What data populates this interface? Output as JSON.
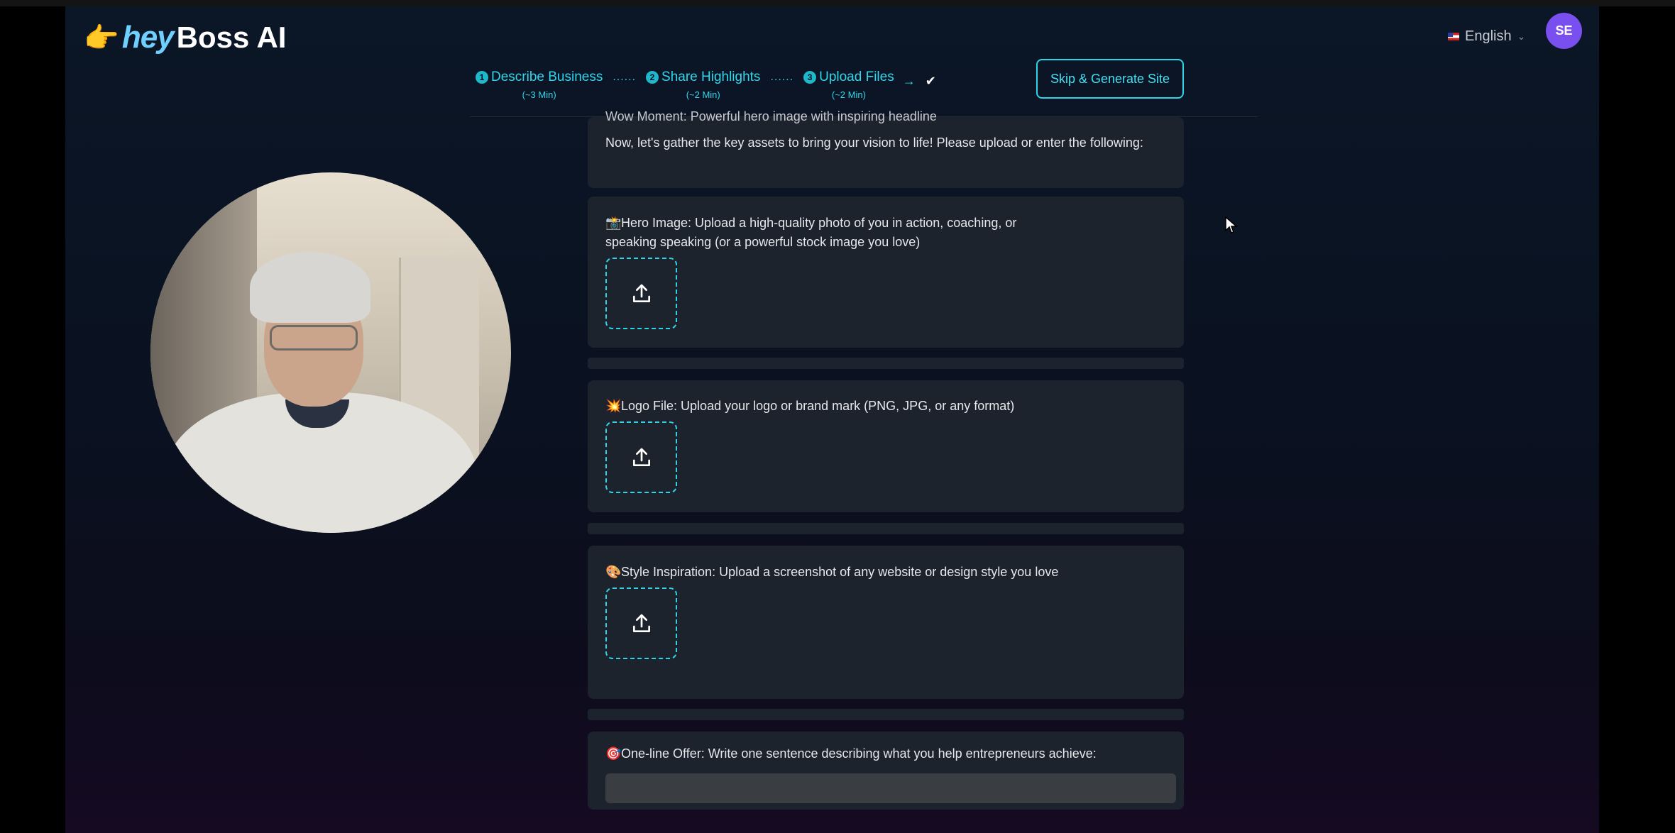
{
  "header": {
    "logo_hey": "hey",
    "logo_boss": "Boss AI",
    "language": "English",
    "avatar_initials": "SE",
    "skip_button": "Skip & Generate Site"
  },
  "steps": [
    {
      "num": "1",
      "label": "Describe Business",
      "duration": "(~3 Min)"
    },
    {
      "num": "2",
      "label": "Share Highlights",
      "duration": "(~2 Min)"
    },
    {
      "num": "3",
      "label": "Upload Files",
      "duration": "(~2 Min)"
    }
  ],
  "steps_separator": "......",
  "intro": {
    "cut_line": "Wow Moment: Powerful hero image with inspiring headline",
    "text": "Now, let's gather the key assets to bring your vision to life! Please upload or enter the following:"
  },
  "hero_image": {
    "emoji": "📸",
    "label": "Hero Image: Upload a high-quality photo of you in action, coaching, or speaking speaking (or a powerful stock image you love)"
  },
  "logo_file": {
    "emoji": "💥",
    "label": "Logo File: Upload your logo or brand mark (PNG, JPG, or any format)"
  },
  "style_inspiration": {
    "emoji": "🎨",
    "label": "Style Inspiration: Upload a screenshot of any website or design style you love"
  },
  "one_line_offer": {
    "emoji": "🎯",
    "label": "One-line Offer: Write one sentence describing what you help entrepreneurs achieve:",
    "value": ""
  },
  "colors": {
    "accent": "#2fd4e6",
    "panel": "#1c232d",
    "avatar": "#7a4ff0"
  }
}
